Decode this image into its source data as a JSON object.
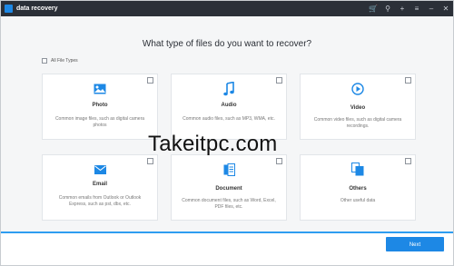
{
  "app": {
    "title": "data recovery"
  },
  "toolbar": {
    "icons": [
      "cart-icon",
      "search-icon",
      "plus-icon",
      "menu-icon",
      "minimize-icon",
      "close-icon"
    ],
    "cart_glyph": "🛒",
    "search_glyph": "⚲",
    "plus_glyph": "+",
    "menu_glyph": "≡",
    "minimize_glyph": "–",
    "close_glyph": "✕"
  },
  "main": {
    "heading": "What type of files do you want to recover?",
    "all_types_label": "All File Types"
  },
  "cards": [
    {
      "name": "Photo",
      "desc": "Common image files, such as digital camera photos",
      "icon": "photo-icon"
    },
    {
      "name": "Audio",
      "desc": "Common audio files, such as MP3, WMA, etc.",
      "icon": "music-icon"
    },
    {
      "name": "Video",
      "desc": "Common video files, such as digital camera recordings.",
      "icon": "play-icon"
    },
    {
      "name": "Email",
      "desc": "Common emails from Outlook or Outlook Express, such as pst, dbx, etc.",
      "icon": "envelope-icon"
    },
    {
      "name": "Document",
      "desc": "Common document files, such as Word, Excel, PDF files, etc.",
      "icon": "document-icon"
    },
    {
      "name": "Others",
      "desc": "Other useful data",
      "icon": "files-icon"
    }
  ],
  "footer": {
    "next_label": "Next"
  },
  "watermark": {
    "text": "Takeitpc.com"
  },
  "colors": {
    "accent": "#1d88e5",
    "titlebar": "#2b3038",
    "background": "#f5f6f7"
  }
}
